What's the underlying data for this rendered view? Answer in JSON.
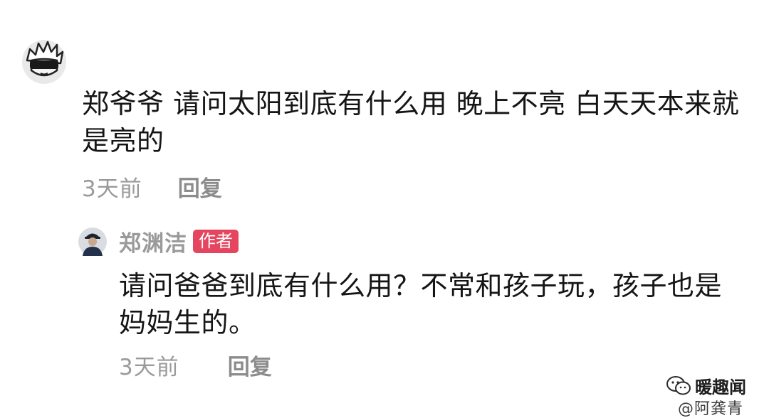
{
  "comment": {
    "avatar_icon": "anime-character-avatar-icon",
    "text": "郑爷爷 请问太阳到底有什么用 晚上不亮 白天天本来就是亮的",
    "time": "3天前",
    "reply_label": "回复"
  },
  "author_reply": {
    "avatar_icon": "author-avatar-icon",
    "author_name": "郑渊洁",
    "badge": "作者",
    "text": "请问爸爸到底有什么用？不常和孩子玩，孩子也是妈妈生的。",
    "time": "3天前",
    "reply_label": "回复"
  },
  "watermark": {
    "channel_icon": "wechat-icon",
    "channel_name": "暖趣闻",
    "weibo_handle": "@阿龚青"
  },
  "colors": {
    "badge": "#e5465f",
    "meta": "#9a9a9a"
  }
}
